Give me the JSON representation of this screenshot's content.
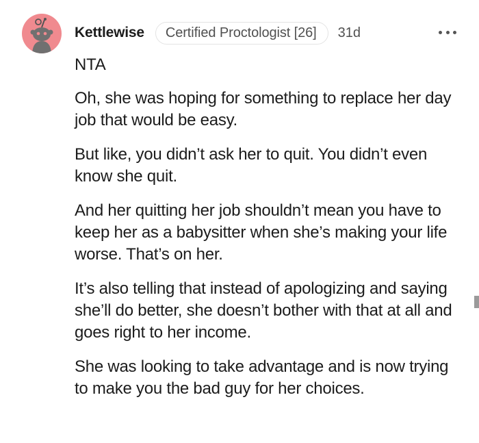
{
  "comment": {
    "author": "Kettlewise",
    "flair": "Certified Proctologist [26]",
    "age": "31d",
    "avatar_icon": "reddit-snoo-avatar-icon",
    "avatar_color": "#f08a8f",
    "more_icon": "more-options-icon",
    "paragraphs": [
      "NTA",
      "Oh, she was hoping for something to replace her day job that would be easy.",
      "But like, you didn’t ask her to quit. You didn’t even know she quit.",
      "And her quitting her job shouldn’t mean you have to keep her as a babysitter when she’s making your life worse. That’s on her.",
      "It’s also telling that instead of apologizing and saying she’ll do better, she doesn’t bother with that at all and goes right to her income.",
      "She was looking to take advantage and is now trying to make you the bad guy for her choices."
    ]
  }
}
